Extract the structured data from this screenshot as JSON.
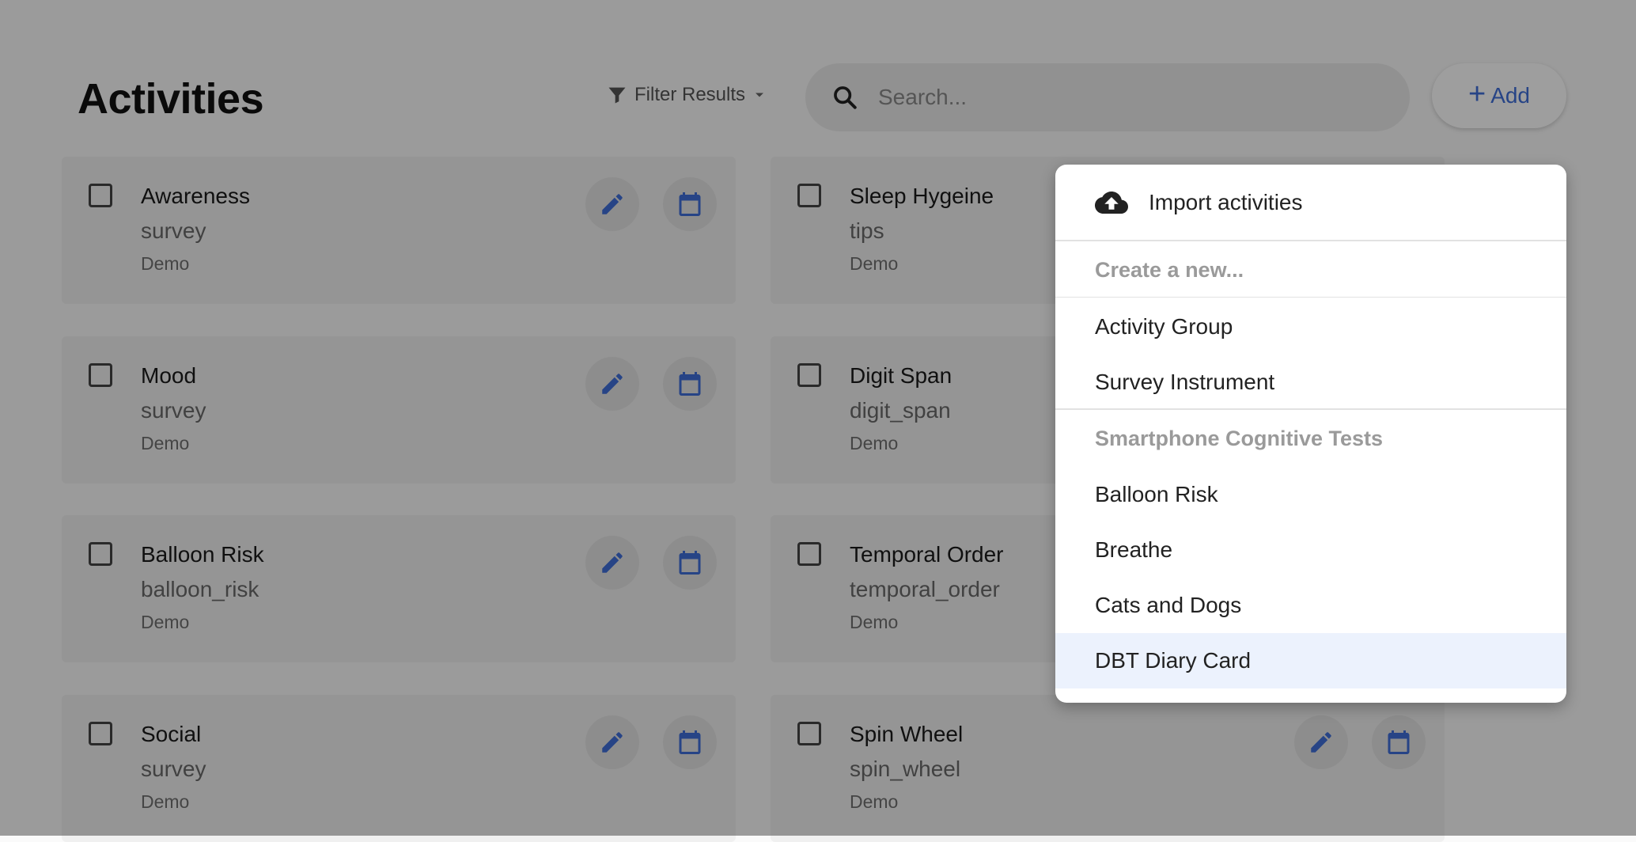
{
  "header": {
    "title": "Activities",
    "filter_label": "Filter Results",
    "search_placeholder": "Search...",
    "add_label": "Add"
  },
  "activities": [
    {
      "name": "Awareness",
      "type": "survey",
      "group": "Demo"
    },
    {
      "name": "Sleep Hygeine",
      "type": "tips",
      "group": "Demo"
    },
    {
      "name": "Mood",
      "type": "survey",
      "group": "Demo"
    },
    {
      "name": "Digit Span",
      "type": "digit_span",
      "group": "Demo"
    },
    {
      "name": "Balloon Risk",
      "type": "balloon_risk",
      "group": "Demo"
    },
    {
      "name": "Temporal Order",
      "type": "temporal_order",
      "group": "Demo"
    },
    {
      "name": "Social",
      "type": "survey",
      "group": "Demo"
    },
    {
      "name": "Spin Wheel",
      "type": "spin_wheel",
      "group": "Demo"
    }
  ],
  "add_menu": {
    "import_label": "Import activities",
    "create_header": "Create a new...",
    "create_items": [
      "Activity Group",
      "Survey Instrument"
    ],
    "cognitive_header": "Smartphone Cognitive Tests",
    "cognitive_items": [
      "Balloon Risk",
      "Breathe",
      "Cats and Dogs",
      "DBT Diary Card"
    ],
    "highlighted_item": "DBT Diary Card"
  },
  "colors": {
    "accent": "#3f6fd8",
    "highlight_bg": "#ecf2fd",
    "overlay": "rgba(0,0,0,0.38)"
  },
  "icons": {
    "filter": "filter-icon",
    "search": "search-icon",
    "add": "plus-icon",
    "edit": "pencil-icon",
    "schedule": "calendar-icon",
    "import": "cloud-upload-icon"
  }
}
